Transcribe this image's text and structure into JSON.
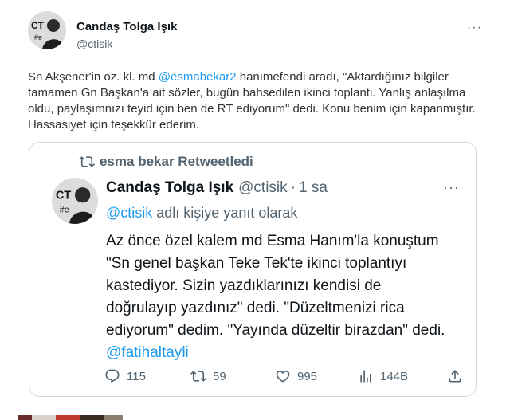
{
  "tweet": {
    "author_name": "Candaş Tolga Işık",
    "author_handle": "@ctisik",
    "text_before": "Sn Akşener'in oz. kl. md ",
    "mention": "@esmabekar2",
    "text_after": " hanımefendi aradı, \"Aktardığınız bilgiler tamamen Gn Başkan'a ait sözler, bugün bahsedilen ikinci toplanti. Yanlış anlaşılma oldu, paylaşımnızı teyid için ben de RT ediyorum\" dedi. Konu benim için kapanmıştır. Hassasiyet için teşekkür ederim.",
    "more_icon": "more-icon"
  },
  "quote": {
    "retweeted_by": "esma bekar Retweetledi",
    "author_name": "Candaş Tolga Işık",
    "author_handle": "@ctisik",
    "dot": "·",
    "time": "1 sa",
    "reply_mention": "@ctisik",
    "reply_text": " adlı kişiye yanıt olarak",
    "body_text": "Az önce özel kalem md Esma Hanım'la konuştum \"Sn genel başkan Teke Tek'te ikinci toplantıyı kastediyor. Sizin yazdıklarınızı kendisi de doğrulayıp yazdınız\" dedi. \"Düzeltmenizi rica ediyorum\" dedim. \"Yayında düzeltir birazdan\" dedi. ",
    "body_mention": "@fatihaltayli",
    "replies": "115",
    "retweets": "59",
    "likes": "995",
    "views": "144B"
  },
  "colors": {
    "accent": "#1d9bf0",
    "muted": "#536471",
    "border": "#cfd9de"
  }
}
